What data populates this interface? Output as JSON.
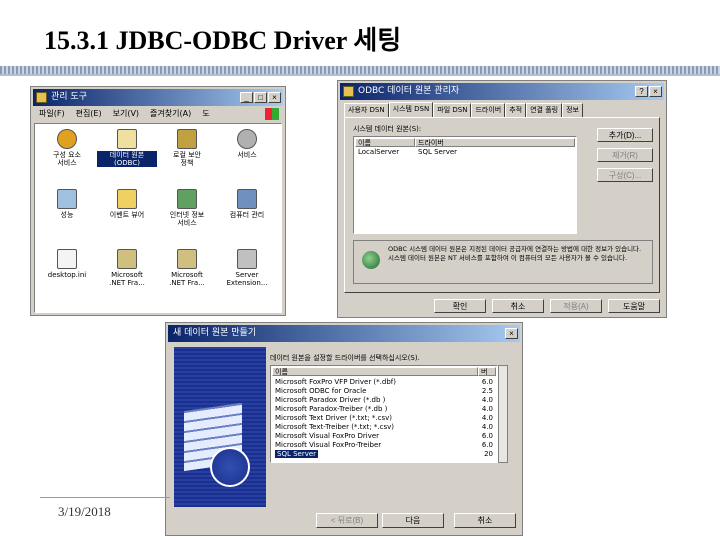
{
  "slide": {
    "title": "15.3.1 JDBC-ODBC Driver 세팅",
    "date": "3/19/2018"
  },
  "admin_tools": {
    "title": "관리 도구",
    "menu": [
      "파일(F)",
      "편집(E)",
      "보기(V)",
      "즐겨찾기(A)",
      "도"
    ],
    "icons": [
      {
        "label": "구성 요소\n서비스",
        "icon": "component-services-icon",
        "selected": false
      },
      {
        "label": "데이터 원본\n(ODBC)",
        "icon": "odbc-data-source-icon",
        "selected": true
      },
      {
        "label": "로컬 보안\n정책",
        "icon": "local-security-icon",
        "selected": false
      },
      {
        "label": "서비스",
        "icon": "services-gear-icon",
        "selected": false
      },
      {
        "label": "성능",
        "icon": "performance-icon",
        "selected": false
      },
      {
        "label": "이벤트 뷰어",
        "icon": "event-viewer-icon",
        "selected": false
      },
      {
        "label": "인터넷 정보\n서비스",
        "icon": "iis-icon",
        "selected": false
      },
      {
        "label": "컴퓨터 관리",
        "icon": "computer-management-icon",
        "selected": false
      },
      {
        "label": "desktop.ini",
        "icon": "ini-file-icon",
        "selected": false
      },
      {
        "label": "Microsoft\n.NET Fra...",
        "icon": "dotnet-tool-icon",
        "selected": false
      },
      {
        "label": "Microsoft\n.NET Fra...",
        "icon": "dotnet-tool-icon",
        "selected": false
      },
      {
        "label": "Server\nExtension...",
        "icon": "server-extension-icon",
        "selected": false
      }
    ]
  },
  "odbc_admin": {
    "title": "ODBC 데이터 원본 관리자",
    "tabs": [
      "사용자 DSN",
      "시스템 DSN",
      "파일 DSN",
      "드라이버",
      "추적",
      "연결 풀링",
      "정보"
    ],
    "section_label": "시스템 데이터 원본(S):",
    "columns": [
      "이름",
      "드라이버"
    ],
    "rows": [
      {
        "name": "LocalServer",
        "driver": "SQL Server"
      }
    ],
    "side_buttons": [
      "추가(D)...",
      "제거(R)",
      "구성(C)..."
    ],
    "info_text": "ODBC 시스템 데이터 원본은 지정된 데이터 공급자에 연결하는 방법에 대한 정보가 있습니다. 시스템 데이터 원본은 NT 서비스를 포함하여 이 컴퓨터의 모든 사용자가 볼 수 있습니다.",
    "bottom_buttons": [
      "확인",
      "취소",
      "적용(A)",
      "도움말"
    ]
  },
  "new_dsn": {
    "title": "새 데이터 원본 만들기",
    "prompt": "데이터 원본을 설정할 드라이버를 선택하십시오(S).",
    "columns": [
      "이름",
      "버"
    ],
    "drivers": [
      {
        "name": "Microsoft FoxPro VFP Driver (*.dbf)",
        "version": "6.0"
      },
      {
        "name": "Microsoft ODBC for Oracle",
        "version": "2.5"
      },
      {
        "name": "Microsoft Paradox Driver (*.db )",
        "version": "4.0"
      },
      {
        "name": "Microsoft Paradox-Treiber (*.db )",
        "version": "4.0"
      },
      {
        "name": "Microsoft Text Driver (*.txt; *.csv)",
        "version": "4.0"
      },
      {
        "name": "Microsoft Text-Treiber (*.txt; *.csv)",
        "version": "4.0"
      },
      {
        "name": "Microsoft Visual FoxPro Driver",
        "version": "6.0"
      },
      {
        "name": "Microsoft Visual FoxPro-Treiber",
        "version": "6.0"
      },
      {
        "name": "SQL Server",
        "version": "20"
      }
    ],
    "buttons": [
      "< 뒤로(B)",
      "다음",
      "취소"
    ]
  }
}
